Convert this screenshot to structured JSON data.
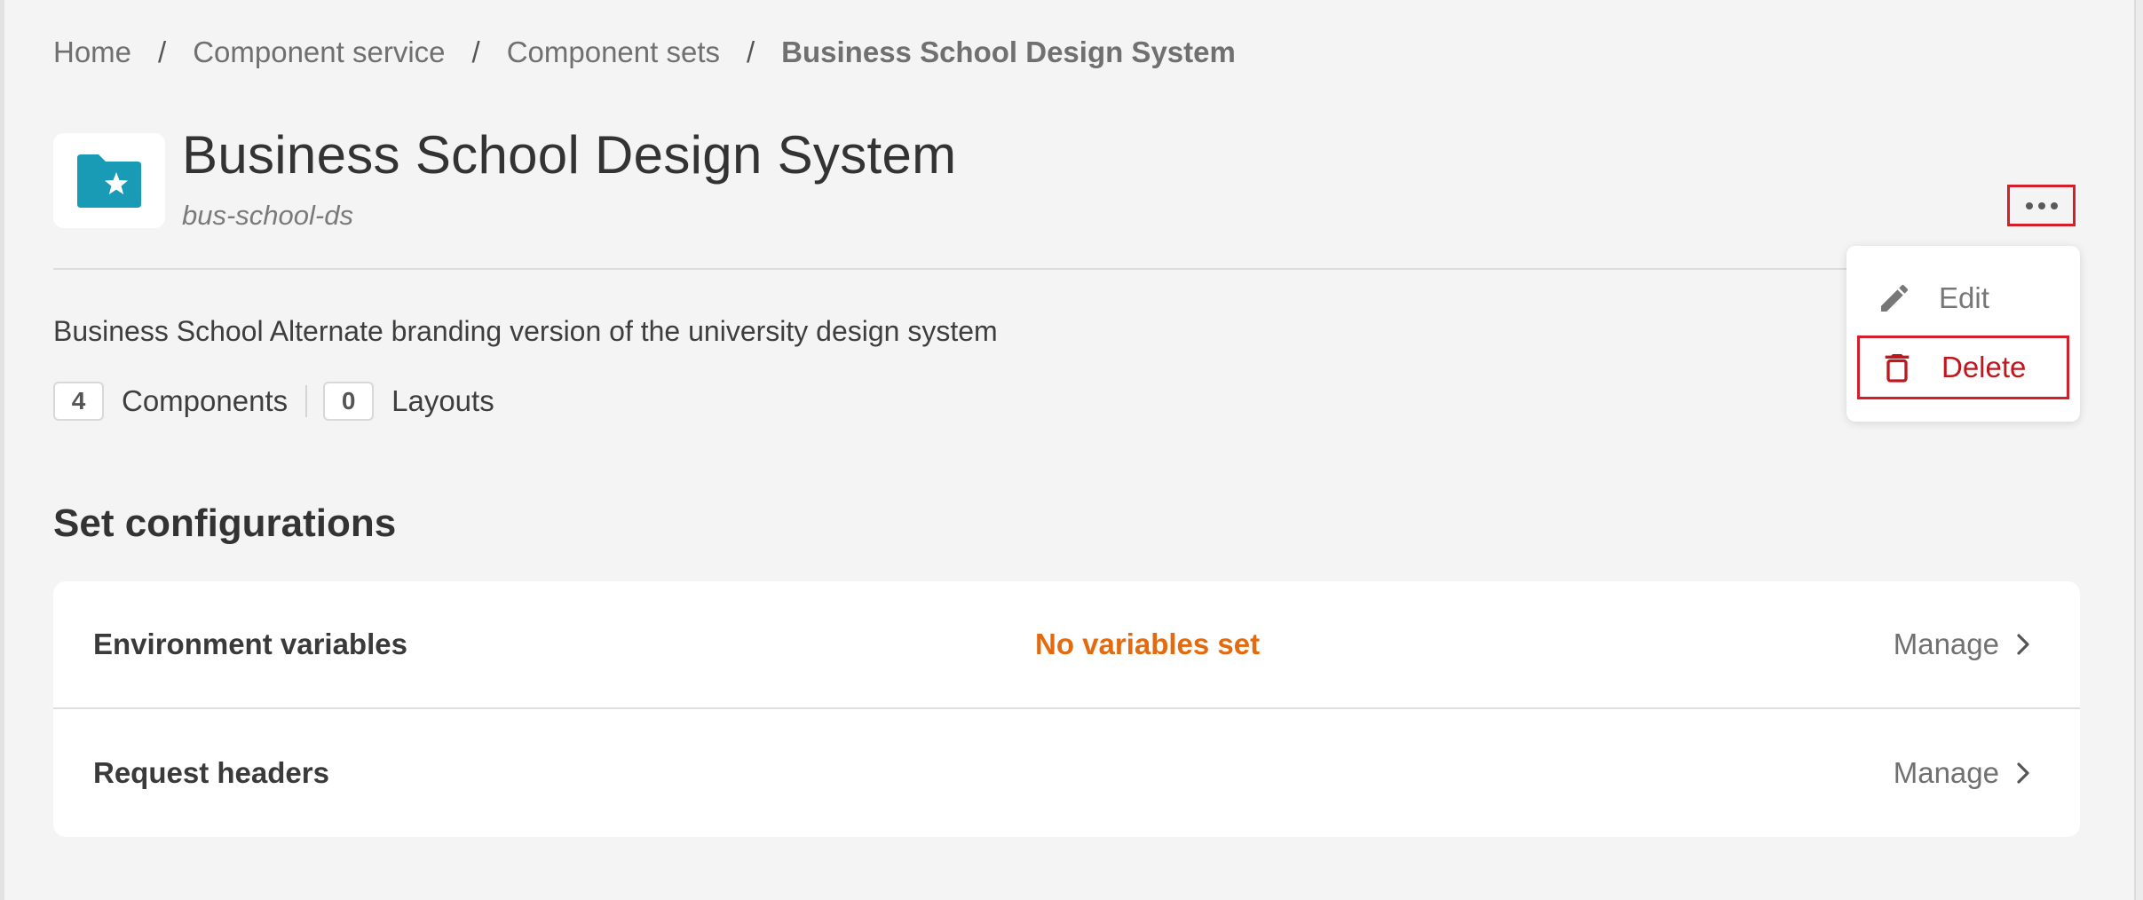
{
  "breadcrumb": {
    "items": [
      "Home",
      "Component service",
      "Component sets"
    ],
    "current": "Business School Design System",
    "separator": "/"
  },
  "header": {
    "title": "Business School Design System",
    "slug": "bus-school-ds",
    "icon": "folder-star-icon",
    "icon_color": "#1a9bb5"
  },
  "description": "Business School Alternate branding version of the university design system",
  "counts": {
    "components": {
      "value": "4",
      "label": "Components"
    },
    "layouts": {
      "value": "0",
      "label": "Layouts"
    }
  },
  "menu": {
    "edit_label": "Edit",
    "delete_label": "Delete",
    "delete_color": "#c0161e"
  },
  "configurations": {
    "title": "Set configurations",
    "rows": [
      {
        "label": "Environment variables",
        "status": "No variables set",
        "action": "Manage"
      },
      {
        "label": "Request headers",
        "status": "",
        "action": "Manage"
      }
    ],
    "status_color": "#e36a0e"
  }
}
